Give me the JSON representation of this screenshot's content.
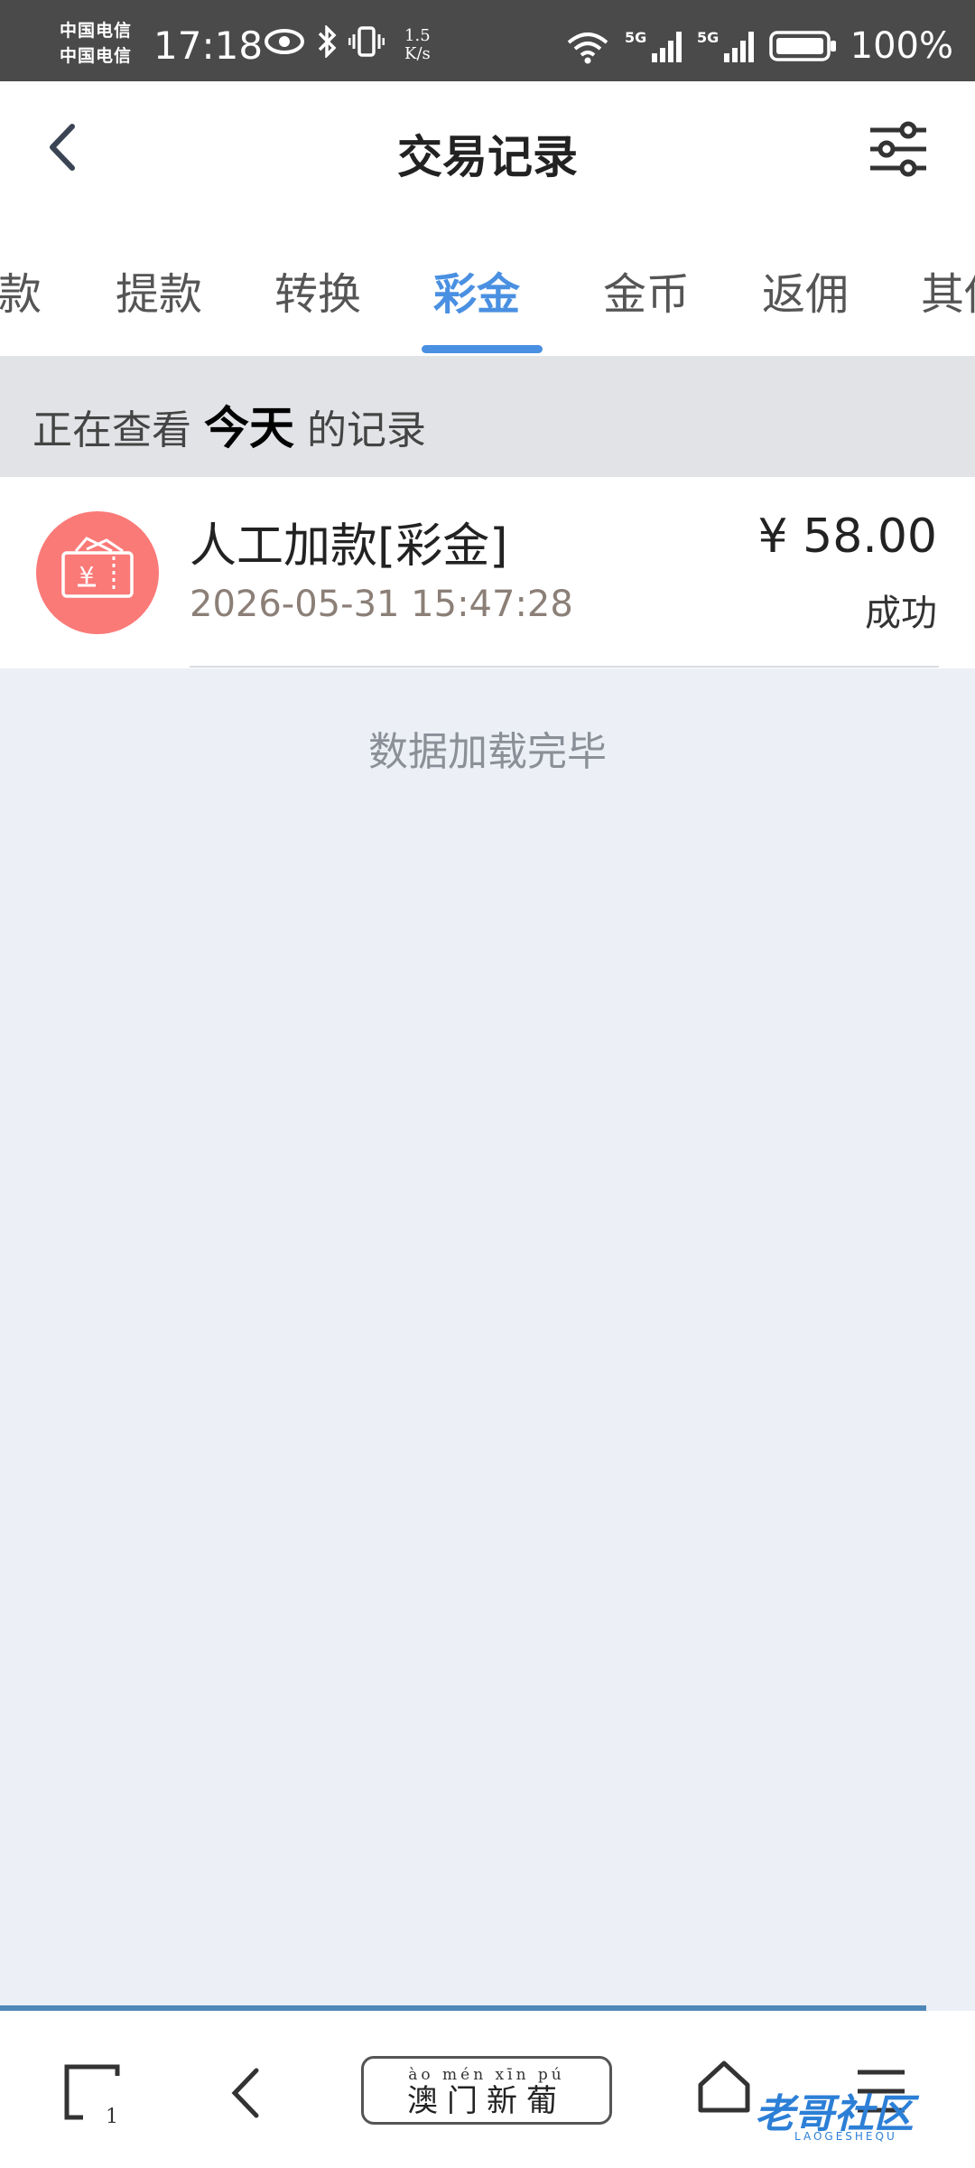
{
  "status_bar": {
    "carrier_1": "中国电信",
    "carrier_2": "中国电信",
    "time": "17:18",
    "speed_value": "1.5",
    "speed_unit": "K/s",
    "battery": "100%"
  },
  "header": {
    "title": "交易记录"
  },
  "tabs": [
    {
      "label": "款"
    },
    {
      "label": "提款"
    },
    {
      "label": "转换"
    },
    {
      "label": "彩金"
    },
    {
      "label": "金币"
    },
    {
      "label": "返佣"
    },
    {
      "label": "其他"
    }
  ],
  "active_tab_index": 3,
  "banner": {
    "prefix": "正在查看",
    "period": "今天",
    "suffix": "的记录"
  },
  "records": [
    {
      "title": "人工加款[彩金]",
      "time": "2026-05-31 15:47:28",
      "amount": "¥ 58.00",
      "status": "成功",
      "icon": "ticket-yen-icon",
      "icon_color": "#fa7a78"
    }
  ],
  "load_status": "数据加载完毕",
  "bottom_nav": {
    "tab_count": "1",
    "brand_pinyin": "ào mén xīn pú",
    "brand_name": "澳门新葡",
    "watermark": "老哥社区",
    "watermark_sub": "LAOGESHEQU"
  },
  "colors": {
    "accent": "#4a90e2",
    "status_bar": "#4a4a4a",
    "page_bg": "#eceff6"
  }
}
